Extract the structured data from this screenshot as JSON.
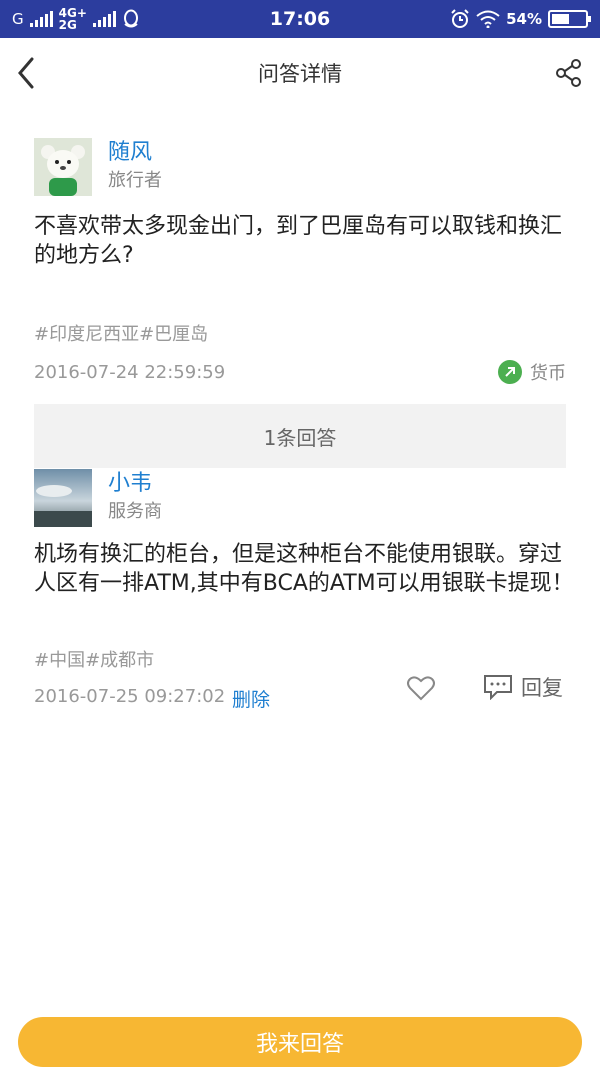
{
  "status_bar": {
    "carrier": "G",
    "network_top": "4G+",
    "network_bottom": "2G",
    "time": "17:06",
    "battery": "54%",
    "battery_level": 0.54
  },
  "header": {
    "title": "问答详情"
  },
  "question": {
    "author_name": "随风",
    "author_role": "旅行者",
    "text": "不喜欢带太多现金出门，到了巴厘岛有可以取钱和换汇的地方么?",
    "tags": "#印度尼西亚#巴厘岛",
    "date": "2016-07-24 22:59:59",
    "category": "货币"
  },
  "answers_header": "1条回答",
  "answer": {
    "author_name": "小韦",
    "author_role": "服务商",
    "text": "机场有换汇的柜台，但是这种柜台不能使用银联。穿过人区有一排ATM,其中有BCA的ATM可以用银联卡提现！",
    "tags": "#中国#成都市",
    "date": "2016-07-25 09:27:02",
    "delete_label": "删除",
    "reply_label": "回复"
  },
  "bottom_button": "我来回答",
  "colors": {
    "status_bar": "#2c3d9e",
    "link_blue": "#1f7fd0",
    "button_orange": "#f7b733",
    "category_green": "#4caf50"
  }
}
